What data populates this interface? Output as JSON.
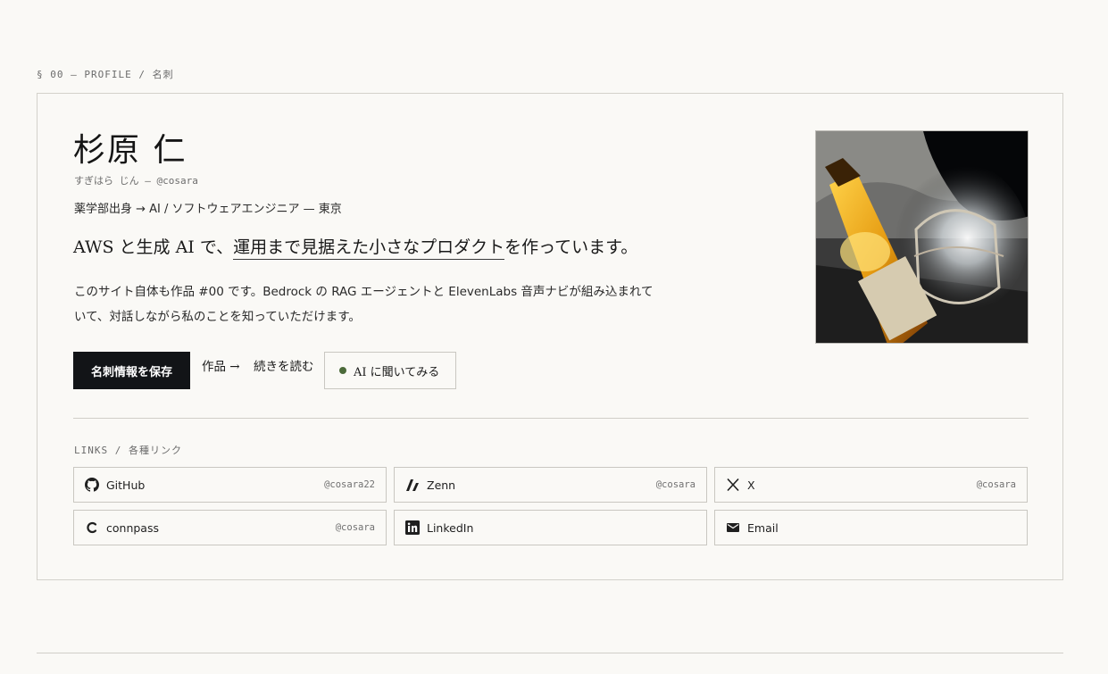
{
  "section_label": "§ 00 — PROFILE / 名刺",
  "profile": {
    "name": "杉原 仁",
    "reading": "すぎはら じん — @cosara",
    "role": "薬学部出身 → AI / ソフトウェアエンジニア — 東京",
    "tagline_pre": "AWS と生成 AI で、",
    "tagline_emph": "運用まで見据えた小さなプロダクト",
    "tagline_post": "を作っています。",
    "description": "このサイト自体も作品 #00 です。Bedrock の RAG エージェントと ElevenLabs 音声ナビが組み込まれていて、対話しながら私のことを知っていただけます。"
  },
  "actions": {
    "save": "名刺情報を保存",
    "works": "作品 →",
    "read_more": "続きを読む",
    "ask_ai": "AI に聞いてみる"
  },
  "links_label": "LINKS / 各種リンク",
  "links": [
    {
      "label": "GitHub",
      "handle": "@cosara22",
      "icon": "github-icon"
    },
    {
      "label": "Zenn",
      "handle": "@cosara",
      "icon": "zenn-icon"
    },
    {
      "label": "X",
      "handle": "@cosara",
      "icon": "x-icon"
    },
    {
      "label": "connpass",
      "handle": "@cosara",
      "icon": "connpass-icon"
    },
    {
      "label": "LinkedIn",
      "handle": "",
      "icon": "linkedin-icon"
    },
    {
      "label": "Email",
      "handle": "",
      "icon": "mail-icon"
    }
  ],
  "colors": {
    "background": "#faf9f6",
    "button_dark": "#121417",
    "status_dot": "#4b6a3a",
    "border": "#c9c7c1"
  }
}
